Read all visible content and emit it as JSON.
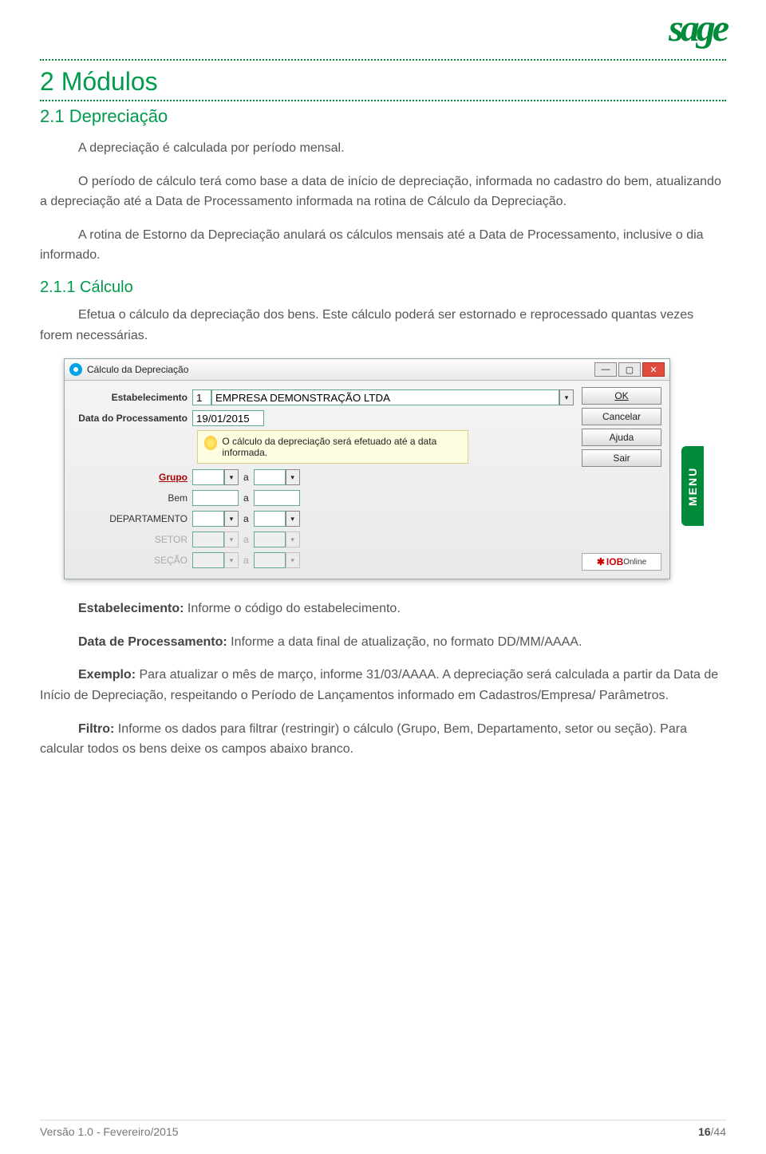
{
  "logo_text": "sage",
  "section": {
    "h1": "2 Módulos",
    "h2": "2.1 Depreciação",
    "p1": "A depreciação é calculada por período mensal.",
    "p2": "O período de cálculo terá como base a data de início de depreciação, informada no cadastro do bem, atualizando a depreciação até a Data de Processamento informada na rotina de Cálculo da Depreciação.",
    "p3": "A rotina de Estorno da Depreciação anulará os cálculos mensais até a Data de Processamento, inclusive o dia informado.",
    "h3": "2.1.1 Cálculo",
    "p4": "Efetua o cálculo da depreciação dos bens. Este cálculo poderá ser estornado e reprocessado quantas vezes forem necessárias."
  },
  "dialog": {
    "title": "Cálculo da Depreciação",
    "labels": {
      "estab": "Estabelecimento",
      "data": "Data do Processamento",
      "grupo": "Grupo",
      "bem": "Bem",
      "depto": "DEPARTAMENTO",
      "setor": "SETOR",
      "secao": "SEÇÃO"
    },
    "values": {
      "estab_code": "1",
      "estab_name": "EMPRESA DEMONSTRAÇÃO LTDA",
      "data": "19/01/2015",
      "a": "a"
    },
    "note": "O cálculo da depreciação será efetuado até a data informada.",
    "buttons": {
      "ok": "OK",
      "cancel": "Cancelar",
      "help": "Ajuda",
      "exit": "Sair"
    },
    "iob": "IOB",
    "iob_online": "Online",
    "menu_tab": "MENU",
    "win_min": "—",
    "win_max": "▢",
    "win_close": "✕",
    "chev": "▾"
  },
  "definitions": {
    "d1_label": "Estabelecimento:",
    "d1_text": " Informe o código do estabelecimento.",
    "d2_label": "Data de Processamento:",
    "d2_text": " Informe a data final de atualização, no formato DD/MM/AAAA.",
    "d3_label": "Exemplo:",
    "d3_text": " Para atualizar o mês de março, informe 31/03/AAAA. A depreciação será calculada a partir da Data de Início de Depreciação, respeitando o Período de Lançamentos informado em Cadastros/Empresa/ Parâmetros.",
    "d4_label": "Filtro:",
    "d4_text": " Informe os dados para filtrar (restringir) o cálculo (Grupo, Bem, Departamento, setor ou seção). Para calcular todos os bens deixe os campos abaixo branco."
  },
  "footer": {
    "version": "Versão 1.0 - Fevereiro/2015",
    "page_current": "16",
    "page_total": "/44"
  }
}
